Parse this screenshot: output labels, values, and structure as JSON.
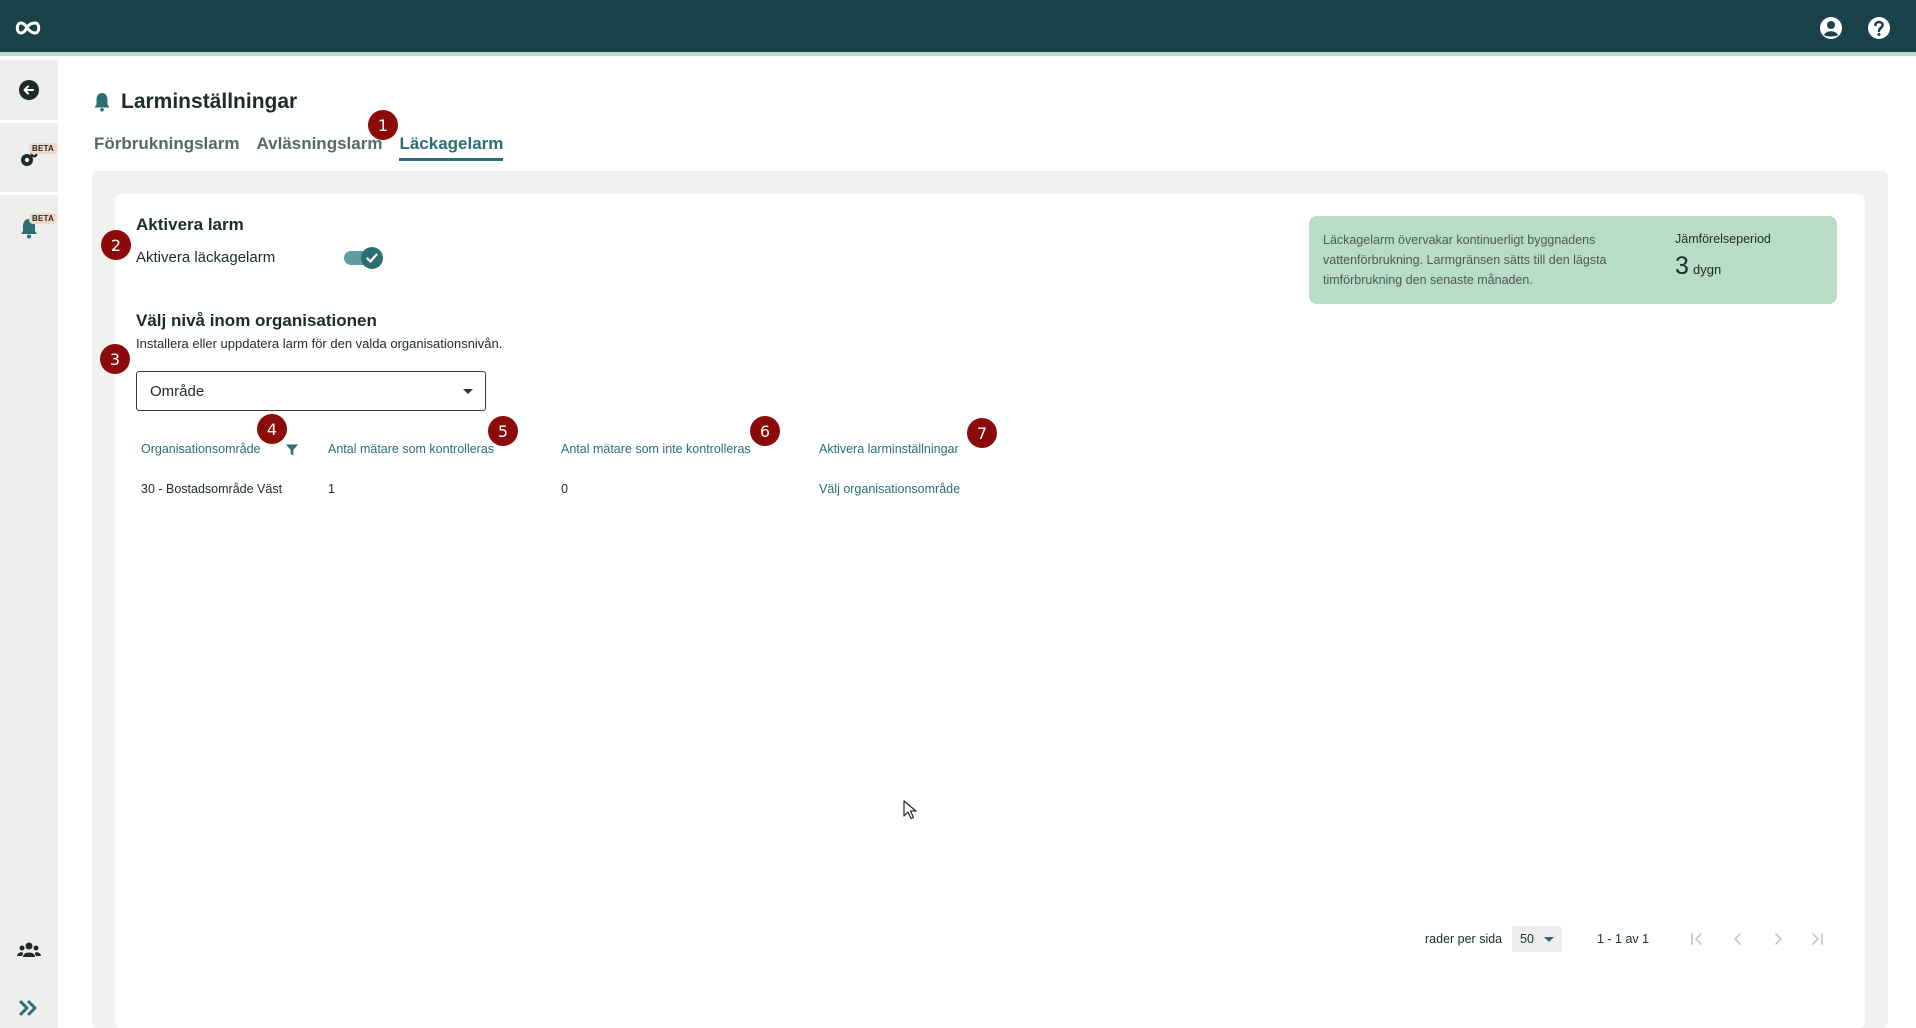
{
  "icons": {
    "logo": "infinity-logo-icon",
    "account": "account-circle-icon",
    "help": "help-circle-icon",
    "back": "arrow-back-icon",
    "settings": "gears-icon",
    "alarm": "bell-icon",
    "users": "users-icon",
    "expand": "double-chevron-right-icon"
  },
  "sidebar": {
    "settings_badge": "BETA",
    "alarm_badge": "BETA"
  },
  "header": {
    "title": "Larminställningar",
    "tabs": [
      {
        "label": "Förbrukningslarm"
      },
      {
        "label": "Avläsningslarm"
      },
      {
        "label": "Läckagelarm"
      }
    ],
    "active_tab": "Läckagelarm"
  },
  "activate": {
    "heading": "Aktivera larm",
    "toggle_label": "Aktivera läckagelarm",
    "toggle_on": true
  },
  "level": {
    "heading": "Välj nivå inom organisationen",
    "description": "Installera eller uppdatera larm för den valda organisationsnivån.",
    "selected": "Område"
  },
  "info": {
    "text": "Läckagelarm övervakar kontinuerligt byggnadens vattenförbrukning. Larmgränsen sätts till den lägsta timförbrukning den senaste månaden.",
    "period_label": "Jämförelseperiod",
    "period_value": "3",
    "period_unit": "dygn"
  },
  "table": {
    "columns": [
      "Organisationsområde",
      "Antal mätare som kontrolleras",
      "Antal mätare som inte kontrolleras",
      "Aktivera larminställningar"
    ],
    "rows": [
      [
        "30 - Bostadsområde Väst",
        "1",
        "0",
        "Välj organisationsområde"
      ]
    ]
  },
  "pagination": {
    "rows_label": "rader per sida",
    "rows_value": "50",
    "range": "1 - 1 av 1"
  },
  "badges": [
    "1",
    "2",
    "3",
    "4",
    "5",
    "6",
    "7"
  ],
  "colors": {
    "topbar": "#1b4149",
    "accent": "#2b6e73",
    "info_bg": "#b9dcc6",
    "badge": "#8b0b0b"
  }
}
